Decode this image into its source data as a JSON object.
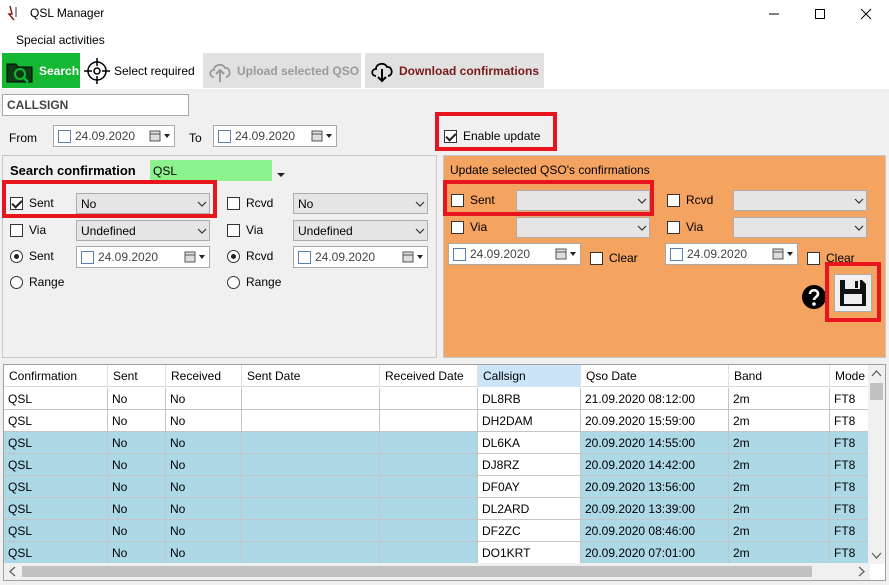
{
  "window": {
    "title": "QSL Manager"
  },
  "menu": {
    "special_activities": "Special activities"
  },
  "toolbar": {
    "search": "Search",
    "select_required": "Select required",
    "upload": "Upload selected QSO",
    "download": "Download confirmations"
  },
  "filter": {
    "callsign_value": "CALLSIGN",
    "from_label": "From",
    "from_date": "24.09.2020",
    "to_label": "To",
    "to_date": "24.09.2020",
    "enable_update": "Enable update"
  },
  "search_panel": {
    "title": "Search confirmation",
    "confirmation_type": "QSL",
    "sent_label": "Sent",
    "sent_value": "No",
    "via_label": "Via",
    "via_value": "Undefined",
    "sent_radio_label": "Sent",
    "sent_date": "24.09.2020",
    "range_label": "Range",
    "rcvd_label": "Rcvd",
    "rcvd_value": "No",
    "via2_label": "Via",
    "via2_value": "Undefined",
    "rcvd_radio_label": "Rcvd",
    "rcvd_date": "24.09.2020",
    "range2_label": "Range"
  },
  "update_panel": {
    "title": "Update selected QSO's confirmations",
    "sent_label": "Sent",
    "via_label": "Via",
    "sent_date": "24.09.2020",
    "clear_label": "Clear",
    "rcvd_label": "Rcvd",
    "via2_label": "Via",
    "rcvd_date": "24.09.2020",
    "clear2_label": "Clear"
  },
  "grid": {
    "columns": [
      "Confirmation",
      "Sent",
      "Received",
      "Sent Date",
      "Received Date",
      "Callsign",
      "Qso Date",
      "Band",
      "Mode"
    ],
    "rows": [
      [
        "QSL",
        "No",
        "No",
        "",
        "",
        "DL8RB",
        "21.09.2020 08:12:00",
        "2m",
        "FT8"
      ],
      [
        "QSL",
        "No",
        "No",
        "",
        "",
        "DH2DAM",
        "20.09.2020 15:59:00",
        "2m",
        "FT8"
      ],
      [
        "QSL",
        "No",
        "No",
        "",
        "",
        "DL6KA",
        "20.09.2020 14:55:00",
        "2m",
        "FT8"
      ],
      [
        "QSL",
        "No",
        "No",
        "",
        "",
        "DJ8RZ",
        "20.09.2020 14:42:00",
        "2m",
        "FT8"
      ],
      [
        "QSL",
        "No",
        "No",
        "",
        "",
        "DF0AY",
        "20.09.2020 13:56:00",
        "2m",
        "FT8"
      ],
      [
        "QSL",
        "No",
        "No",
        "",
        "",
        "DL2ARD",
        "20.09.2020 13:39:00",
        "2m",
        "FT8"
      ],
      [
        "QSL",
        "No",
        "No",
        "",
        "",
        "DF2ZC",
        "20.09.2020 08:46:00",
        "2m",
        "FT8"
      ],
      [
        "QSL",
        "No",
        "No",
        "",
        "",
        "DO1KRT",
        "20.09.2020 07:01:00",
        "2m",
        "FT8"
      ]
    ]
  },
  "colors": {
    "search_green": "#14b832",
    "update_orange": "#f4a361",
    "highlight_red": "#e8141e",
    "row_blue": "#add8e6"
  }
}
